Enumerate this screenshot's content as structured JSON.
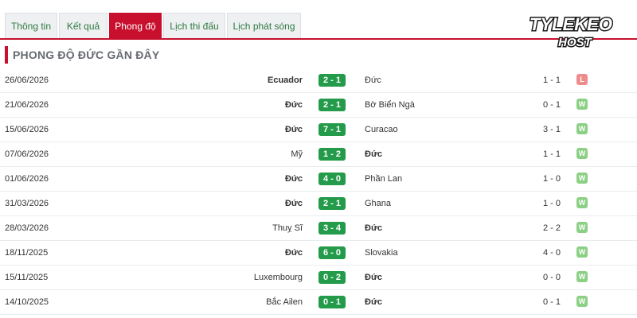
{
  "tabs": [
    {
      "label": "Thông tin",
      "active": false
    },
    {
      "label": "Kết quả",
      "active": false
    },
    {
      "label": "Phong độ",
      "active": true
    },
    {
      "label": "Lịch thi đấu",
      "active": false
    },
    {
      "label": "Lịch phát sóng",
      "active": false
    }
  ],
  "logo": {
    "line1": "TYLEKEO",
    "line2": "HOST"
  },
  "section_title": "PHONG ĐỘ ĐỨC GẦN ĐÂY",
  "matches": [
    {
      "date": "26/06/2026",
      "home": "Ecuador",
      "score": "2 - 1",
      "away": "Đức",
      "half": "1 - 1",
      "result": "L",
      "bold": "home"
    },
    {
      "date": "21/06/2026",
      "home": "Đức",
      "score": "2 - 1",
      "away": "Bờ Biển Ngà",
      "half": "0 - 1",
      "result": "W",
      "bold": "home"
    },
    {
      "date": "15/06/2026",
      "home": "Đức",
      "score": "7 - 1",
      "away": "Curacao",
      "half": "3 - 1",
      "result": "W",
      "bold": "home"
    },
    {
      "date": "07/06/2026",
      "home": "Mỹ",
      "score": "1 - 2",
      "away": "Đức",
      "half": "1 - 1",
      "result": "W",
      "bold": "away"
    },
    {
      "date": "01/06/2026",
      "home": "Đức",
      "score": "4 - 0",
      "away": "Phần Lan",
      "half": "1 - 0",
      "result": "W",
      "bold": "home"
    },
    {
      "date": "31/03/2026",
      "home": "Đức",
      "score": "2 - 1",
      "away": "Ghana",
      "half": "1 - 0",
      "result": "W",
      "bold": "home"
    },
    {
      "date": "28/03/2026",
      "home": "Thuỵ Sĩ",
      "score": "3 - 4",
      "away": "Đức",
      "half": "2 - 2",
      "result": "W",
      "bold": "away"
    },
    {
      "date": "18/11/2025",
      "home": "Đức",
      "score": "6 - 0",
      "away": "Slovakia",
      "half": "4 - 0",
      "result": "W",
      "bold": "home"
    },
    {
      "date": "15/11/2025",
      "home": "Luxembourg",
      "score": "0 - 2",
      "away": "Đức",
      "half": "0 - 0",
      "result": "W",
      "bold": "away"
    },
    {
      "date": "14/10/2025",
      "home": "Bắc Ailen",
      "score": "0 - 1",
      "away": "Đức",
      "half": "0 - 1",
      "result": "W",
      "bold": "away"
    }
  ]
}
